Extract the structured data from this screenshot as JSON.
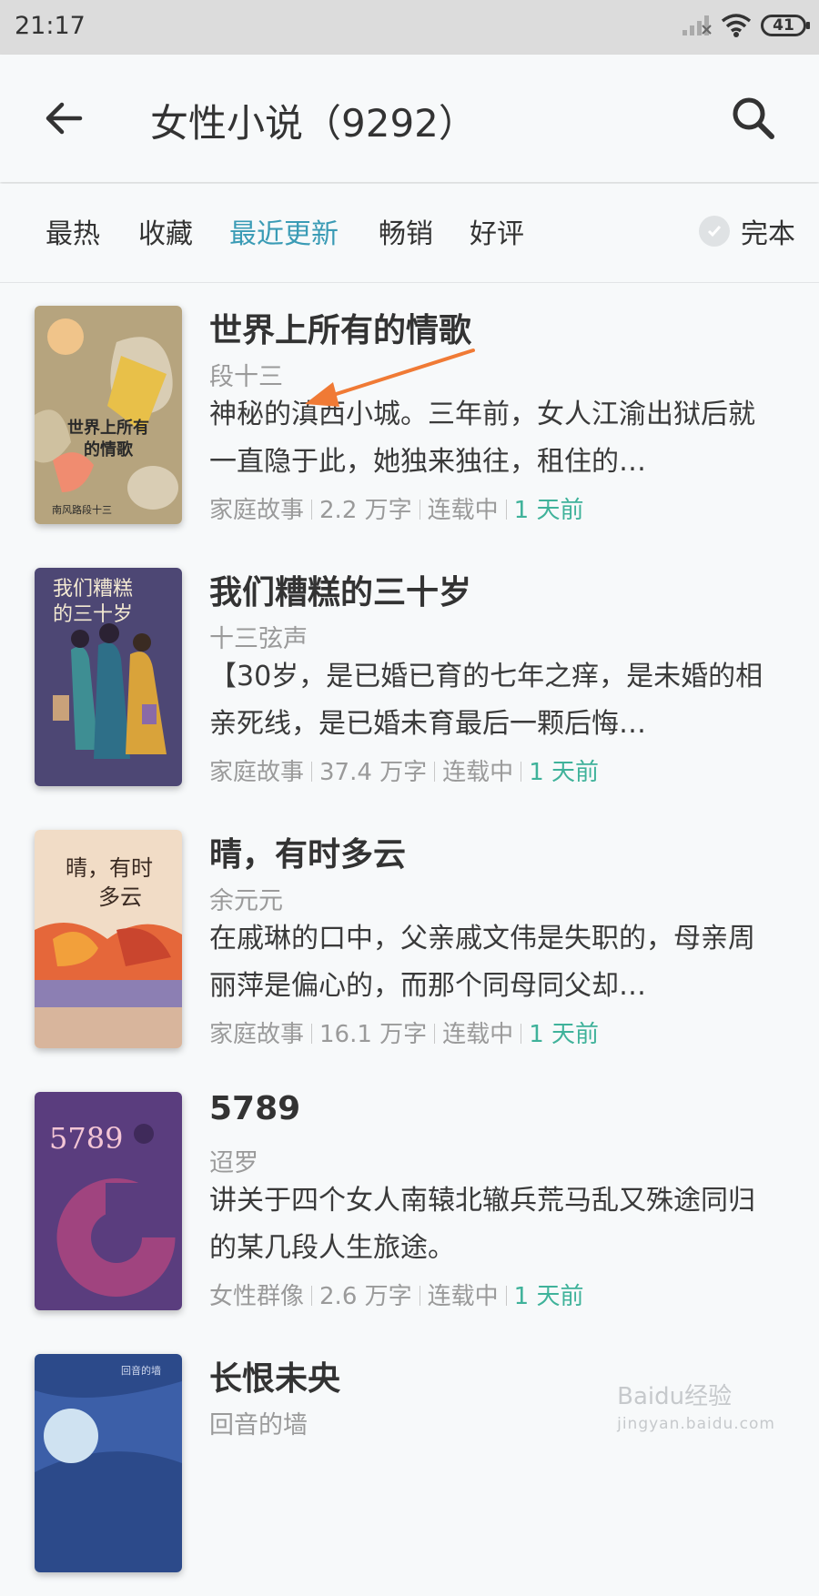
{
  "status_bar": {
    "time": "21:17",
    "battery": "41"
  },
  "header": {
    "title": "女性小说（9292）"
  },
  "filters": {
    "tabs": [
      {
        "label": "最热"
      },
      {
        "label": "收藏"
      },
      {
        "label": "最近更新",
        "active": true
      },
      {
        "label": "畅销"
      },
      {
        "label": "好评"
      }
    ],
    "complete_label": "完本"
  },
  "books": [
    {
      "title": "世界上所有的情歌",
      "author": "段十三",
      "description": "神秘的滇西小城。三年前，女人江渝出狱后就一直隐于此，她独来独往，租住的…",
      "genre": "家庭故事",
      "words": "2.2 万字",
      "status": "连载中",
      "updated": "1 天前",
      "cover": {
        "text": "世界上所有的情歌",
        "subtext": "南风路段十三"
      }
    },
    {
      "title": "我们糟糕的三十岁",
      "author": "十三弦声",
      "description": "【30岁，是已婚已育的七年之痒，是未婚的相亲死线，是已婚未育最后一颗后悔…",
      "genre": "家庭故事",
      "words": "37.4 万字",
      "status": "连载中",
      "updated": "1 天前",
      "cover": {
        "text": "我们糟糕的三十岁"
      }
    },
    {
      "title": "晴，有时多云",
      "author": "余元元",
      "description": "在戚琳的口中，父亲戚文伟是失职的，母亲周丽萍是偏心的，而那个同母同父却…",
      "genre": "家庭故事",
      "words": "16.1 万字",
      "status": "连载中",
      "updated": "1 天前",
      "cover": {
        "text": "晴，有时多云"
      }
    },
    {
      "title": "5789",
      "author": "迢罗",
      "description": "讲关于四个女人南辕北辙兵荒马乱又殊途同归的某几段人生旅途。",
      "genre": "女性群像",
      "words": "2.6 万字",
      "status": "连载中",
      "updated": "1 天前",
      "cover": {
        "text": "5789"
      }
    },
    {
      "title": "长恨未央",
      "author": "回音的墙",
      "description": "",
      "genre": "",
      "words": "",
      "status": "",
      "updated": "",
      "cover": {
        "text": "回音的墙"
      }
    }
  ],
  "watermark": {
    "text": "Baidu经验",
    "url": "jingyan.baidu.com"
  },
  "colors": {
    "accent": "#3a9bb5",
    "updated": "#3fb29a",
    "arrow": "#f07a35"
  }
}
